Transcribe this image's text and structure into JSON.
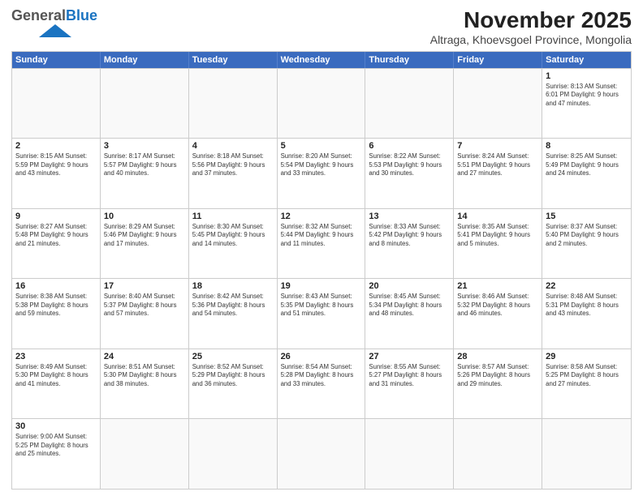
{
  "header": {
    "logo_text_general": "General",
    "logo_text_blue": "Blue",
    "title": "November 2025",
    "subtitle": "Altraga, Khoevsgoel Province, Mongolia"
  },
  "weekdays": [
    "Sunday",
    "Monday",
    "Tuesday",
    "Wednesday",
    "Thursday",
    "Friday",
    "Saturday"
  ],
  "weeks": [
    [
      {
        "day": "",
        "info": ""
      },
      {
        "day": "",
        "info": ""
      },
      {
        "day": "",
        "info": ""
      },
      {
        "day": "",
        "info": ""
      },
      {
        "day": "",
        "info": ""
      },
      {
        "day": "",
        "info": ""
      },
      {
        "day": "1",
        "info": "Sunrise: 8:13 AM\nSunset: 6:01 PM\nDaylight: 9 hours\nand 47 minutes."
      }
    ],
    [
      {
        "day": "2",
        "info": "Sunrise: 8:15 AM\nSunset: 5:59 PM\nDaylight: 9 hours\nand 43 minutes."
      },
      {
        "day": "3",
        "info": "Sunrise: 8:17 AM\nSunset: 5:57 PM\nDaylight: 9 hours\nand 40 minutes."
      },
      {
        "day": "4",
        "info": "Sunrise: 8:18 AM\nSunset: 5:56 PM\nDaylight: 9 hours\nand 37 minutes."
      },
      {
        "day": "5",
        "info": "Sunrise: 8:20 AM\nSunset: 5:54 PM\nDaylight: 9 hours\nand 33 minutes."
      },
      {
        "day": "6",
        "info": "Sunrise: 8:22 AM\nSunset: 5:53 PM\nDaylight: 9 hours\nand 30 minutes."
      },
      {
        "day": "7",
        "info": "Sunrise: 8:24 AM\nSunset: 5:51 PM\nDaylight: 9 hours\nand 27 minutes."
      },
      {
        "day": "8",
        "info": "Sunrise: 8:25 AM\nSunset: 5:49 PM\nDaylight: 9 hours\nand 24 minutes."
      }
    ],
    [
      {
        "day": "9",
        "info": "Sunrise: 8:27 AM\nSunset: 5:48 PM\nDaylight: 9 hours\nand 21 minutes."
      },
      {
        "day": "10",
        "info": "Sunrise: 8:29 AM\nSunset: 5:46 PM\nDaylight: 9 hours\nand 17 minutes."
      },
      {
        "day": "11",
        "info": "Sunrise: 8:30 AM\nSunset: 5:45 PM\nDaylight: 9 hours\nand 14 minutes."
      },
      {
        "day": "12",
        "info": "Sunrise: 8:32 AM\nSunset: 5:44 PM\nDaylight: 9 hours\nand 11 minutes."
      },
      {
        "day": "13",
        "info": "Sunrise: 8:33 AM\nSunset: 5:42 PM\nDaylight: 9 hours\nand 8 minutes."
      },
      {
        "day": "14",
        "info": "Sunrise: 8:35 AM\nSunset: 5:41 PM\nDaylight: 9 hours\nand 5 minutes."
      },
      {
        "day": "15",
        "info": "Sunrise: 8:37 AM\nSunset: 5:40 PM\nDaylight: 9 hours\nand 2 minutes."
      }
    ],
    [
      {
        "day": "16",
        "info": "Sunrise: 8:38 AM\nSunset: 5:38 PM\nDaylight: 8 hours\nand 59 minutes."
      },
      {
        "day": "17",
        "info": "Sunrise: 8:40 AM\nSunset: 5:37 PM\nDaylight: 8 hours\nand 57 minutes."
      },
      {
        "day": "18",
        "info": "Sunrise: 8:42 AM\nSunset: 5:36 PM\nDaylight: 8 hours\nand 54 minutes."
      },
      {
        "day": "19",
        "info": "Sunrise: 8:43 AM\nSunset: 5:35 PM\nDaylight: 8 hours\nand 51 minutes."
      },
      {
        "day": "20",
        "info": "Sunrise: 8:45 AM\nSunset: 5:34 PM\nDaylight: 8 hours\nand 48 minutes."
      },
      {
        "day": "21",
        "info": "Sunrise: 8:46 AM\nSunset: 5:32 PM\nDaylight: 8 hours\nand 46 minutes."
      },
      {
        "day": "22",
        "info": "Sunrise: 8:48 AM\nSunset: 5:31 PM\nDaylight: 8 hours\nand 43 minutes."
      }
    ],
    [
      {
        "day": "23",
        "info": "Sunrise: 8:49 AM\nSunset: 5:30 PM\nDaylight: 8 hours\nand 41 minutes."
      },
      {
        "day": "24",
        "info": "Sunrise: 8:51 AM\nSunset: 5:30 PM\nDaylight: 8 hours\nand 38 minutes."
      },
      {
        "day": "25",
        "info": "Sunrise: 8:52 AM\nSunset: 5:29 PM\nDaylight: 8 hours\nand 36 minutes."
      },
      {
        "day": "26",
        "info": "Sunrise: 8:54 AM\nSunset: 5:28 PM\nDaylight: 8 hours\nand 33 minutes."
      },
      {
        "day": "27",
        "info": "Sunrise: 8:55 AM\nSunset: 5:27 PM\nDaylight: 8 hours\nand 31 minutes."
      },
      {
        "day": "28",
        "info": "Sunrise: 8:57 AM\nSunset: 5:26 PM\nDaylight: 8 hours\nand 29 minutes."
      },
      {
        "day": "29",
        "info": "Sunrise: 8:58 AM\nSunset: 5:25 PM\nDaylight: 8 hours\nand 27 minutes."
      }
    ],
    [
      {
        "day": "30",
        "info": "Sunrise: 9:00 AM\nSunset: 5:25 PM\nDaylight: 8 hours\nand 25 minutes."
      },
      {
        "day": "",
        "info": ""
      },
      {
        "day": "",
        "info": ""
      },
      {
        "day": "",
        "info": ""
      },
      {
        "day": "",
        "info": ""
      },
      {
        "day": "",
        "info": ""
      },
      {
        "day": "",
        "info": ""
      }
    ]
  ]
}
